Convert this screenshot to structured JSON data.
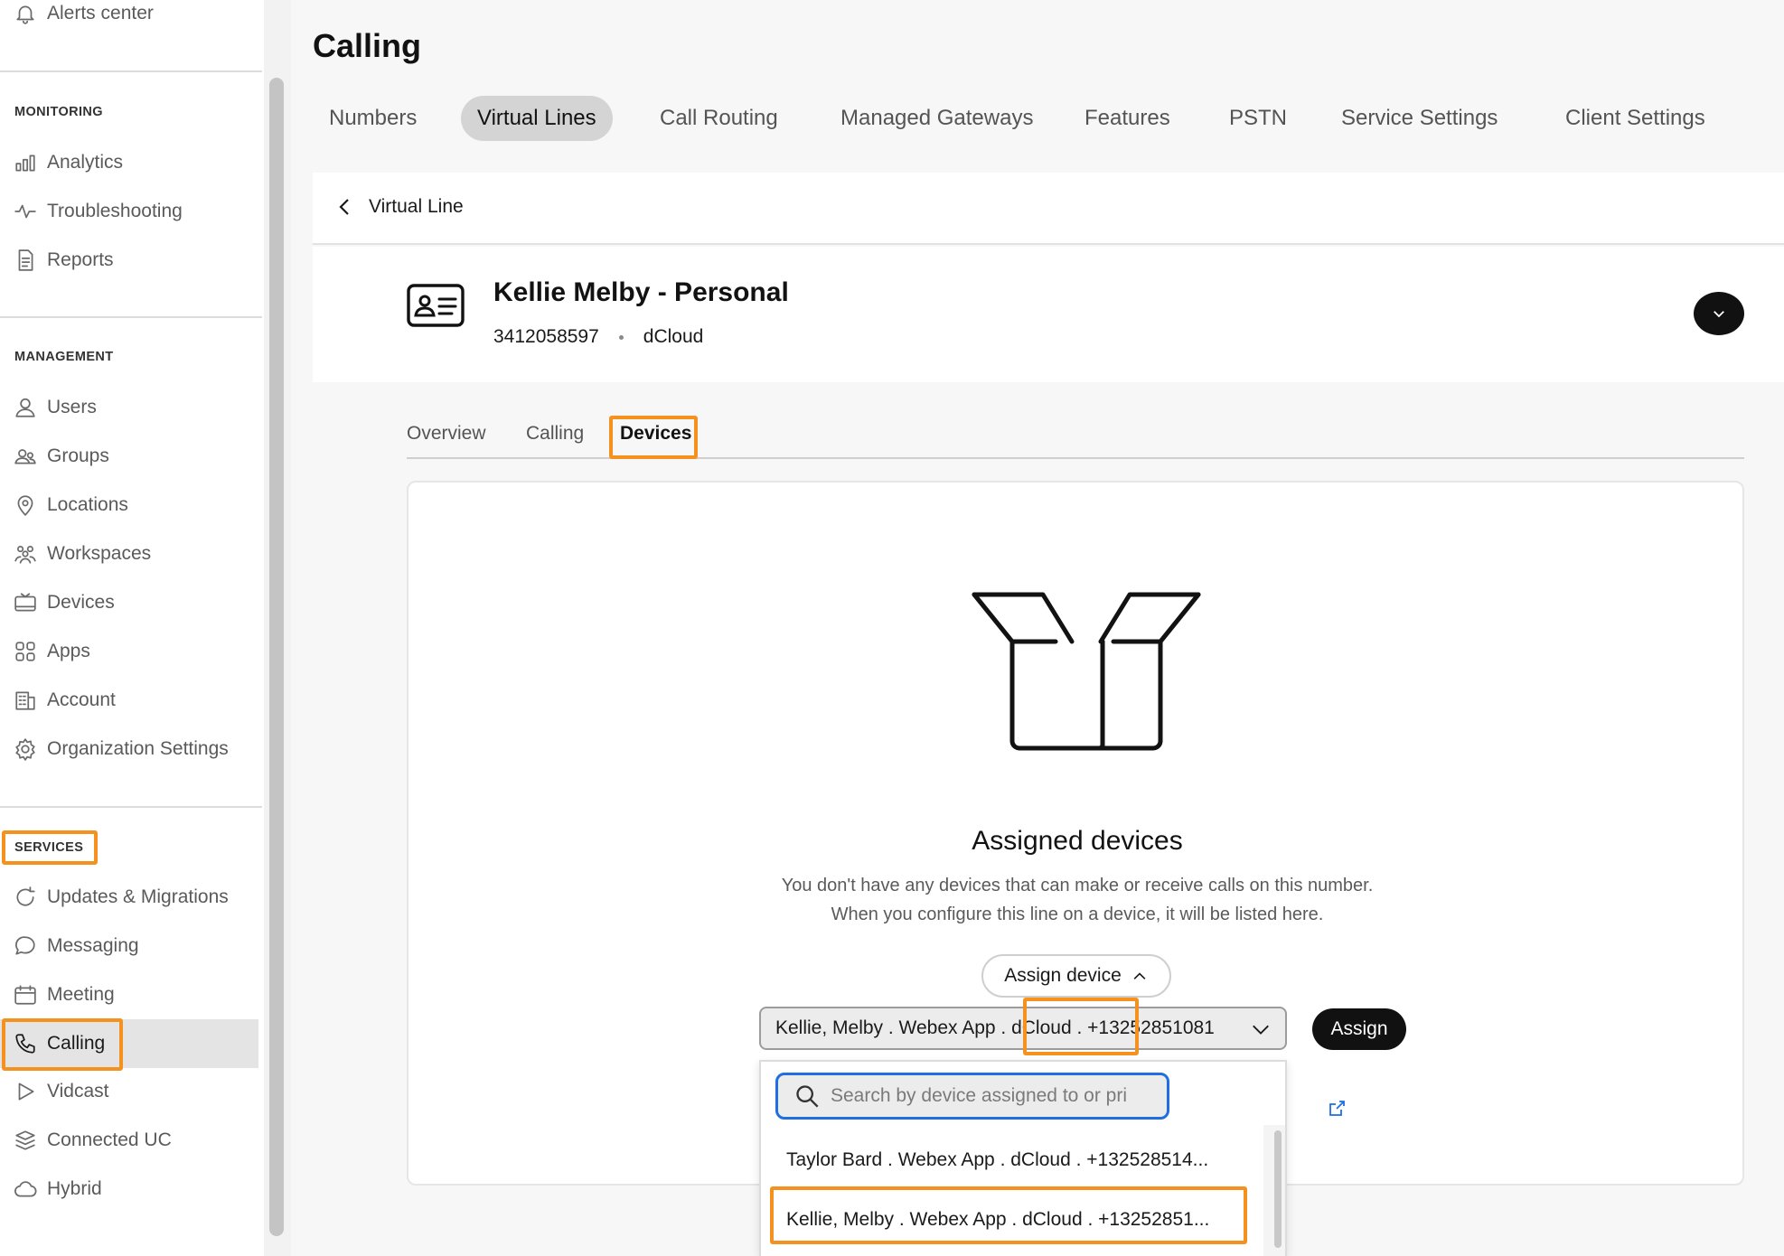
{
  "sidebar": {
    "alerts_center": "Alerts center",
    "sections": [
      {
        "heading": "MONITORING",
        "items": [
          "Analytics",
          "Troubleshooting",
          "Reports"
        ]
      },
      {
        "heading": "MANAGEMENT",
        "items": [
          "Users",
          "Groups",
          "Locations",
          "Workspaces",
          "Devices",
          "Apps",
          "Account",
          "Organization Settings"
        ]
      },
      {
        "heading": "SERVICES",
        "items": [
          "Updates & Migrations",
          "Messaging",
          "Meeting",
          "Calling",
          "Vidcast",
          "Connected UC",
          "Hybrid"
        ]
      }
    ],
    "active_item": "Calling"
  },
  "header": {
    "title": "Calling",
    "tabs": [
      "Numbers",
      "Virtual Lines",
      "Call Routing",
      "Managed Gateways",
      "Features",
      "PSTN",
      "Service Settings",
      "Client Settings"
    ],
    "active_tab": "Virtual Lines"
  },
  "breadcrumb": {
    "back_label": "Virtual Line"
  },
  "entity": {
    "name": "Kellie Melby - Personal",
    "number": "3412058597",
    "org": "dCloud"
  },
  "sub_tabs": {
    "items": [
      "Overview",
      "Calling",
      "Devices"
    ],
    "active": "Devices"
  },
  "devices_panel": {
    "title": "Assigned devices",
    "description_line1": "You don't have any devices that can make or receive calls on this number.",
    "description_line2": "When you configure this line on a device, it will be listed here.",
    "assign_device_label": "Assign device",
    "selected_device": "Kellie, Melby . Webex App . dCloud . +13252851081",
    "assign_button": "Assign"
  },
  "dropdown": {
    "search_placeholder": "Search by device assigned to or pri",
    "options": [
      "Taylor Bard . Webex App . dCloud . +132528514...",
      "Kellie, Melby . Webex App . dCloud . +13252851..."
    ]
  },
  "colors": {
    "highlight": "#f5911e",
    "focus": "#1f6fe0",
    "primary_button": "#111111"
  }
}
